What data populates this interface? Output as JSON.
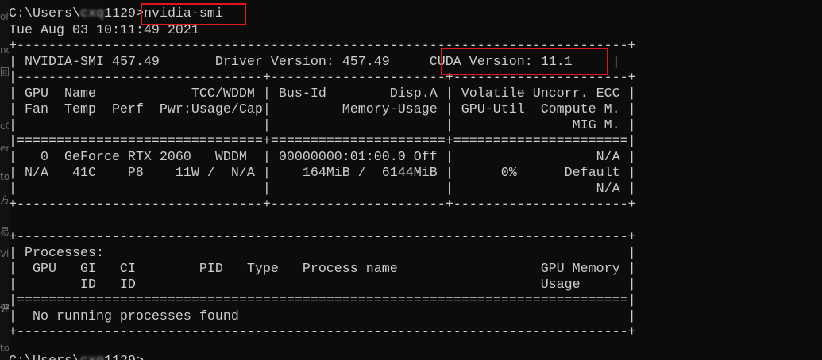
{
  "window": {
    "background": "#0c0c0c",
    "foreground": "#cccccc",
    "highlight_color": "#e0151f"
  },
  "left_strip": {
    "fragments": [
      "olC",
      "no",
      "回",
      "cC",
      "er",
      "to",
      "方",
      "易",
      "Vir",
      "评",
      "to"
    ]
  },
  "prompt": {
    "prefix": "C:\\Users\\",
    "user": "cxq",
    "suffix": "1129>",
    "command": "nvidia-smi"
  },
  "timestamp": "Tue Aug 03 10:11:49 2021",
  "table": {
    "rule_top": "+-----------------------------------------------------------------------------+",
    "header": {
      "smi_label": "NVIDIA-SMI 457.49",
      "driver_label": "Driver Version: 457.49",
      "cuda_label": "CUDA Version: 11.1"
    },
    "rule_mid": "|-------------------------------+----------------------+----------------------+",
    "columns": [
      "| GPU  Name            TCC/WDDM | Bus-Id        Disp.A | Volatile Uncorr. ECC |",
      "| Fan  Temp  Perf  Pwr:Usage/Cap|         Memory-Usage | GPU-Util  Compute M. |",
      "|                               |                      |               MIG M. |"
    ],
    "rule_double": "|===============================+======================+======================|",
    "gpu_rows": [
      "|   0  GeForce RTX 2060   WDDM  | 00000000:01:00.0 Off |                  N/A |",
      "| N/A   41C    P8    11W /  N/A |    164MiB /  6144MiB |      0%      Default |",
      "|                               |                      |                  N/A |"
    ],
    "rule_bottom": "+-------------------------------+----------------------+----------------------+"
  },
  "processes": {
    "rule_top": "+-----------------------------------------------------------------------------+",
    "title": "| Processes:                                                                  |",
    "col_row_1": "|  GPU   GI   CI        PID   Type   Process name                  GPU Memory |",
    "col_row_2": "|        ID   ID                                                   Usage      |",
    "rule_double": "|=============================================================================|",
    "empty_message": "|  No running processes found                                                 |",
    "rule_bottom": "+-----------------------------------------------------------------------------+"
  },
  "next_prompt": {
    "prefix": "C:\\Users\\",
    "user": "cxq",
    "suffix": "1129>"
  }
}
